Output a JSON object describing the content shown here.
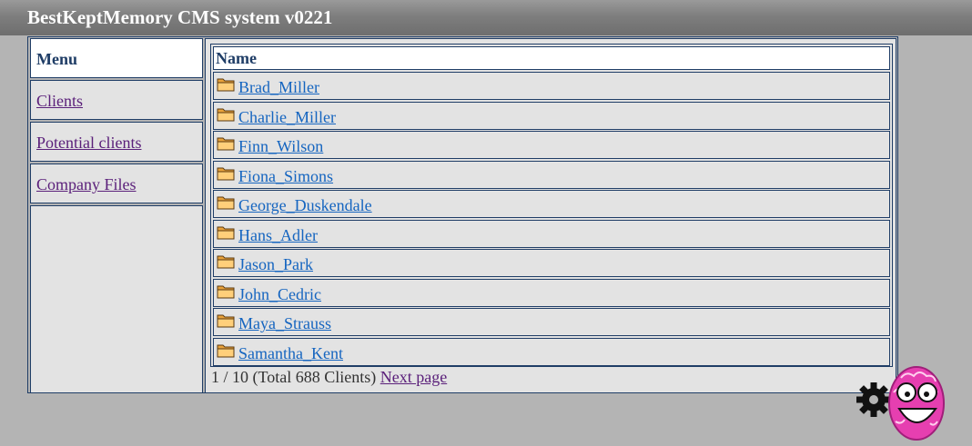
{
  "app": {
    "title": "BestKeptMemory CMS system v0221"
  },
  "menu": {
    "heading": "Menu",
    "items": [
      {
        "label": "Clients"
      },
      {
        "label": "Potential clients"
      },
      {
        "label": "Company Files"
      }
    ]
  },
  "list": {
    "column_header": "Name",
    "rows": [
      {
        "name": "Brad_Miller",
        "icon": "folder-icon"
      },
      {
        "name": "Charlie_Miller",
        "icon": "folder-icon"
      },
      {
        "name": "Finn_Wilson",
        "icon": "folder-icon"
      },
      {
        "name": "Fiona_Simons",
        "icon": "folder-icon"
      },
      {
        "name": "George_Duskendale",
        "icon": "folder-icon"
      },
      {
        "name": "Hans_Adler",
        "icon": "folder-icon"
      },
      {
        "name": "Jason_Park",
        "icon": "folder-icon"
      },
      {
        "name": "John_Cedric",
        "icon": "folder-icon"
      },
      {
        "name": "Maya_Strauss",
        "icon": "folder-icon"
      },
      {
        "name": "Samantha_Kent",
        "icon": "folder-icon"
      }
    ]
  },
  "pagination": {
    "status": "1 / 10 (Total 688 Clients)",
    "next_label": "Next page"
  },
  "mascot": {
    "icon": "brain-gear-mascot-icon"
  },
  "colors": {
    "header_bg": "#7e7e7e",
    "page_bg": "#b4b4b4",
    "panel_bg": "#e3e3e3",
    "border": "#1f3d66",
    "client_link": "#1565c0",
    "visited_link": "#5a1f7a"
  }
}
